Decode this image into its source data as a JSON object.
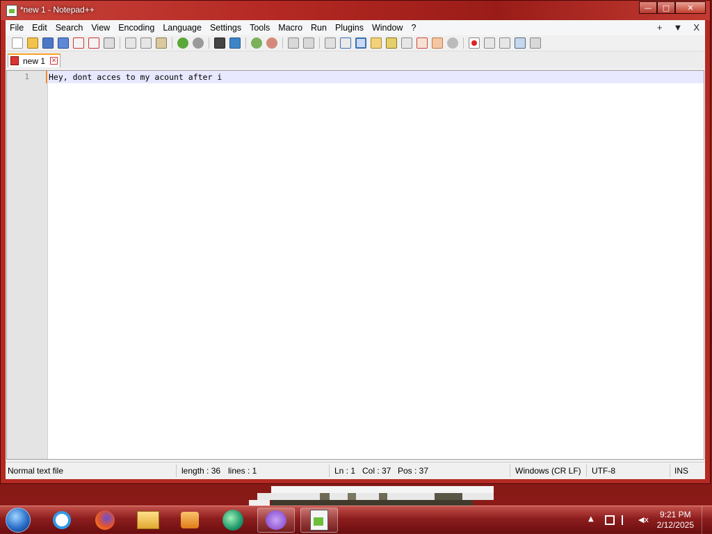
{
  "window": {
    "title": "*new 1 - Notepad++",
    "controls": {
      "minimize": "—",
      "maximize": "□",
      "close": "✕"
    }
  },
  "menu": {
    "items": [
      "File",
      "Edit",
      "Search",
      "View",
      "Encoding",
      "Language",
      "Settings",
      "Tools",
      "Macro",
      "Run",
      "Plugins",
      "Window",
      "?"
    ],
    "right": {
      "new_tab": "+",
      "tab_list": "▼",
      "close_doc": "X"
    }
  },
  "toolbar": {
    "icons": [
      "new-file-icon",
      "open-file-icon",
      "save-icon",
      "save-all-icon",
      "close-icon",
      "close-all-icon",
      "print-icon",
      "cut-icon",
      "copy-icon",
      "paste-icon",
      "undo-icon",
      "redo-icon",
      "find-icon",
      "replace-icon",
      "zoom-in-icon",
      "zoom-out-icon",
      "sync-vertical-icon",
      "sync-horizontal-icon",
      "word-wrap-icon",
      "show-all-chars-icon",
      "indent-guide-icon",
      "udl-icon",
      "doc-map-icon",
      "function-list-icon",
      "folder-workspace-icon",
      "doc-list-icon",
      "monitoring-icon",
      "record-macro-icon",
      "stop-macro-icon",
      "play-macro-icon",
      "run-macro-multiple-icon",
      "save-macro-icon"
    ]
  },
  "tabs": [
    {
      "label": "new 1",
      "close": "✕"
    }
  ],
  "editor": {
    "lines": [
      {
        "number": "1",
        "text": "Hey, dont acces to my acount after i"
      }
    ]
  },
  "status": {
    "file_type": "Normal text file",
    "length": "length : 36",
    "lines": "lines : 1",
    "ln": "Ln : 1",
    "col": "Col : 37",
    "pos": "Pos : 37",
    "eol": "Windows (CR LF)",
    "encoding": "UTF-8",
    "mode": "INS"
  },
  "taskbar": {
    "apps": [
      "internet-explorer-icon",
      "firefox-icon",
      "file-explorer-icon",
      "media-player-icon",
      "edge-globe-icon",
      "mask-app-icon",
      "notepadpp-icon"
    ],
    "clock": {
      "time": "9:21 PM",
      "date": "2/12/2025"
    }
  }
}
